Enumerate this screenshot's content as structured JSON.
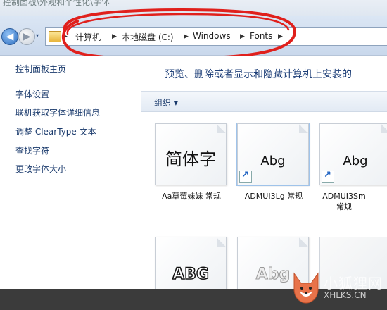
{
  "window": {
    "partial_title": "控制面板\\外观和个性化\\字体"
  },
  "nav": {
    "back_label": "◀",
    "forward_label": "▶",
    "dropdown_label": "▾"
  },
  "address": {
    "crumbs": [
      "计算机",
      "本地磁盘 (C:)",
      "Windows",
      "Fonts"
    ],
    "separator": "▶"
  },
  "sidebar": {
    "home": "控制面板主页",
    "items": [
      "字体设置",
      "联机获取字体详细信息",
      "调整 ClearType 文本",
      "查找字符",
      "更改字体大小"
    ]
  },
  "main": {
    "description": "预览、删除或者显示和隐藏计算机上安装的",
    "organize_label": "组织 ▾",
    "fonts": [
      {
        "preview": "简体字",
        "label": "Aa草莓妹妹 常规",
        "shortcut": false
      },
      {
        "preview": "Abg",
        "label": "ADMUI3Lg 常规",
        "shortcut": true
      },
      {
        "preview": "Abg",
        "label": "ADMUI3Sm 常规",
        "shortcut": true
      },
      {
        "preview": "ABG",
        "label": "",
        "shortcut": false
      },
      {
        "preview": "Abg",
        "label": "",
        "shortcut": false
      }
    ]
  },
  "watermark": {
    "name": "小狐狸网",
    "url": "XHLKS.CN"
  },
  "colors": {
    "annotation": "#e0201c",
    "link": "#1a3a6c",
    "heading": "#1e3f78"
  }
}
